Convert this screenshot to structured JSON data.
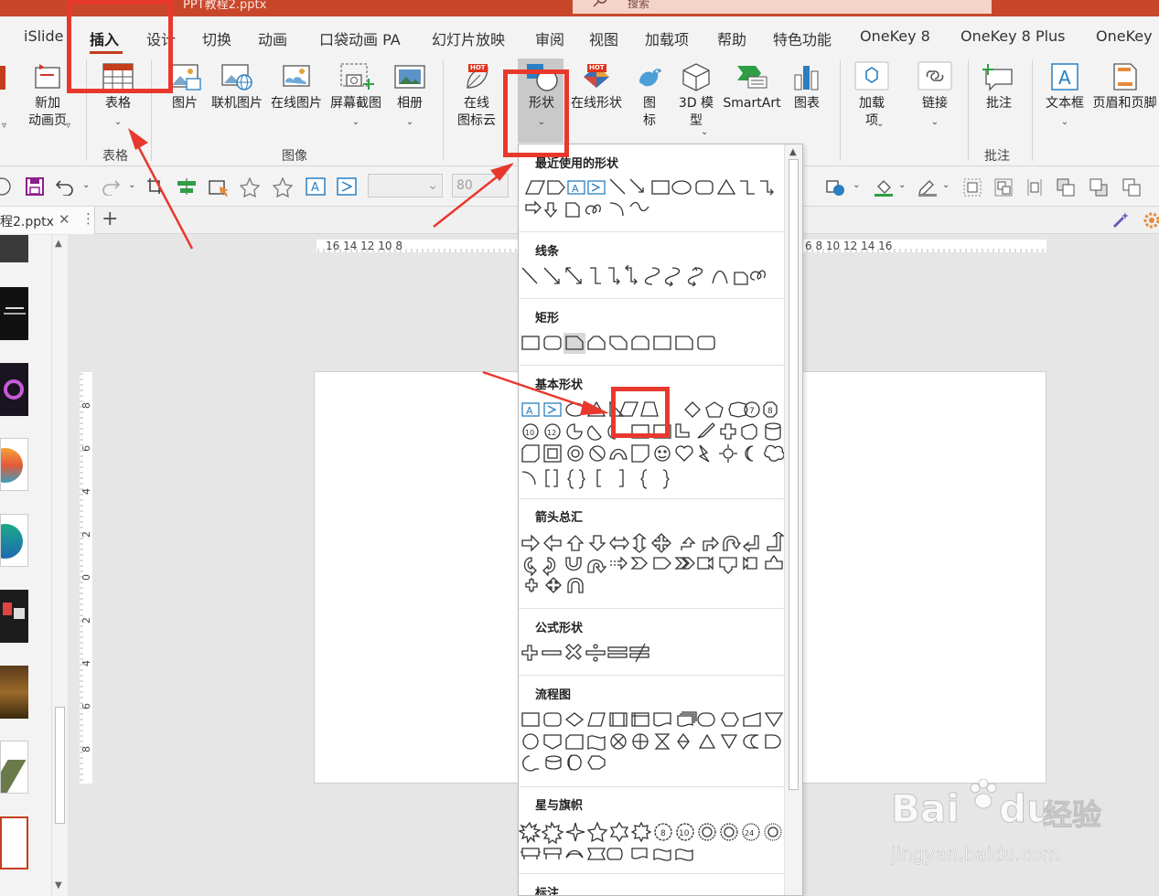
{
  "titlebar": {
    "title": "PPT教程2.pptx",
    "search_label": "搜索"
  },
  "menu_tabs": [
    "iSlide",
    "插入",
    "设计",
    "切换",
    "动画",
    "口袋动画 PA",
    "幻灯片放映",
    "审阅",
    "视图",
    "加载项",
    "帮助",
    "特色功能",
    "OneKey 8",
    "OneKey 8 Plus",
    "OneKey"
  ],
  "ribbon": {
    "new_page_l1": "新加",
    "new_page_l2": "动画页",
    "table": "表格",
    "picture": "图片",
    "online_pic": "联机图片",
    "online_pic2": "在线图片",
    "screenshot": "屏幕截图",
    "album": "相册",
    "online_icon_l1": "在线",
    "online_icon_l2": "图标云",
    "shape": "形状",
    "online_shape": "在线形状",
    "icon_l1": "图",
    "icon_l2": "标",
    "model_l1": "3D 模",
    "model_l2": "型",
    "smartart": "SmartArt",
    "chart": "图表",
    "addin_l1": "加载",
    "addin_l2": "项",
    "link": "链接",
    "comment": "批注",
    "textbox": "文本框",
    "header_footer": "页眉和页脚",
    "groups": {
      "table": "表格",
      "image": "图像",
      "comment": "批注"
    },
    "hot": "HOT"
  },
  "qat": {
    "font_size": "80"
  },
  "doc_tab": {
    "label": "程2.pptx",
    "close": "✕",
    "menu": "⋮",
    "new": "+"
  },
  "ruler": {
    "h_left": "16 14 12 10 8",
    "h_right": "6 8 10 12 14 16",
    "v_labels": [
      "8",
      "6",
      "4",
      "2",
      "0",
      "2",
      "4",
      "6",
      "8"
    ]
  },
  "shape_menu": {
    "recent": "最近使用的形状",
    "lines": "线条",
    "rect": "矩形",
    "basic": "基本形状",
    "arrows": "箭头总汇",
    "equation": "公式形状",
    "flowchart": "流程图",
    "stars": "星与旗帜",
    "callouts": "标注"
  },
  "basic_shapes_labels": [
    "A",
    "7",
    "8",
    "10",
    "12"
  ],
  "star_labels": [
    "8",
    "10",
    "24"
  ],
  "watermark": {
    "logo": "Bai",
    "du": "du",
    "jingyan": "经验",
    "url": "jingyan.baidu.com"
  },
  "colors": {
    "accent": "#c43e1c",
    "title_bar": "#c8472b",
    "annotation": "#e8382e"
  }
}
